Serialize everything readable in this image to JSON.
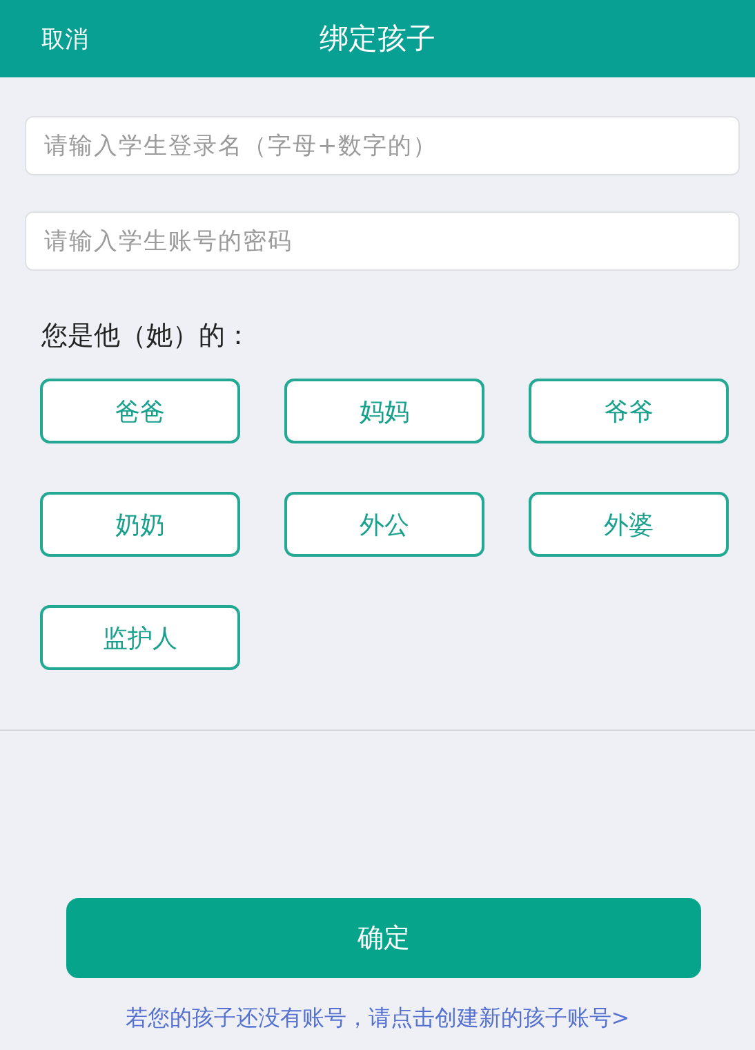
{
  "header": {
    "cancel": "取消",
    "title": "绑定孩子"
  },
  "fields": [
    {
      "placeholder": "请输入学生登录名（字母+数字的）"
    },
    {
      "placeholder": "请输入学生账号的密码"
    }
  ],
  "relation_label": "您是他（她）的：",
  "relations": [
    {
      "label": "爸爸",
      "selected": false
    },
    {
      "label": "妈妈",
      "selected": false
    },
    {
      "label": "爷爷",
      "selected": false
    },
    {
      "label": "奶奶",
      "selected": false
    },
    {
      "label": "外公",
      "selected": false
    },
    {
      "label": "外婆",
      "selected": false
    },
    {
      "label": "监护人",
      "selected": false
    }
  ],
  "confirm": "确定",
  "create_link": "若您的孩子还没有账号，请点击创建新的孩子账号>"
}
